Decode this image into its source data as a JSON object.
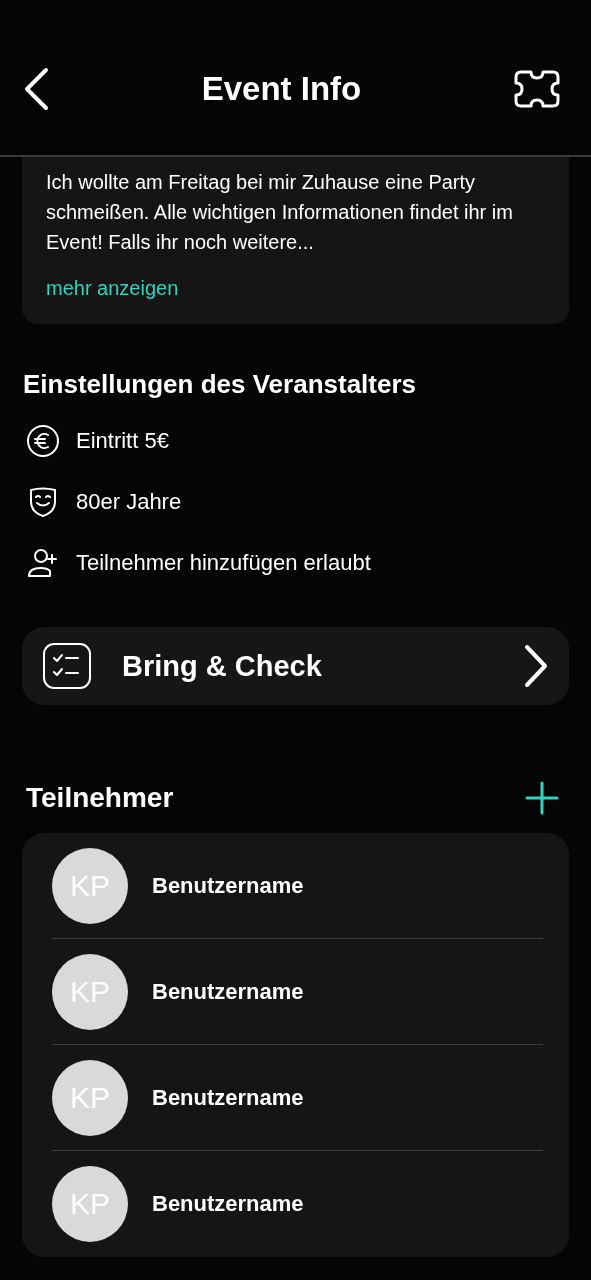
{
  "header": {
    "title": "Event Info"
  },
  "description": {
    "text": "Ich wollte am Freitag bei mir Zuhause eine Party schmeißen. Alle wichtigen Informationen findet ihr im Event! Falls ihr noch weitere...",
    "more_link": "mehr anzeigen"
  },
  "settings": {
    "title": "Einstellungen des Veranstalters",
    "items": [
      {
        "kind": "price",
        "label": "Eintritt 5€"
      },
      {
        "kind": "theme",
        "label": "80er Jahre"
      },
      {
        "kind": "guests",
        "label": "Teilnehmer hinzufügen erlaubt"
      }
    ]
  },
  "bring_check": {
    "label": "Bring & Check"
  },
  "participants": {
    "title": "Teilnehmer",
    "items": [
      {
        "initials": "KP",
        "name": "Benutzername"
      },
      {
        "initials": "KP",
        "name": "Benutzername"
      },
      {
        "initials": "KP",
        "name": "Benutzername"
      },
      {
        "initials": "KP",
        "name": "Benutzername"
      }
    ]
  }
}
